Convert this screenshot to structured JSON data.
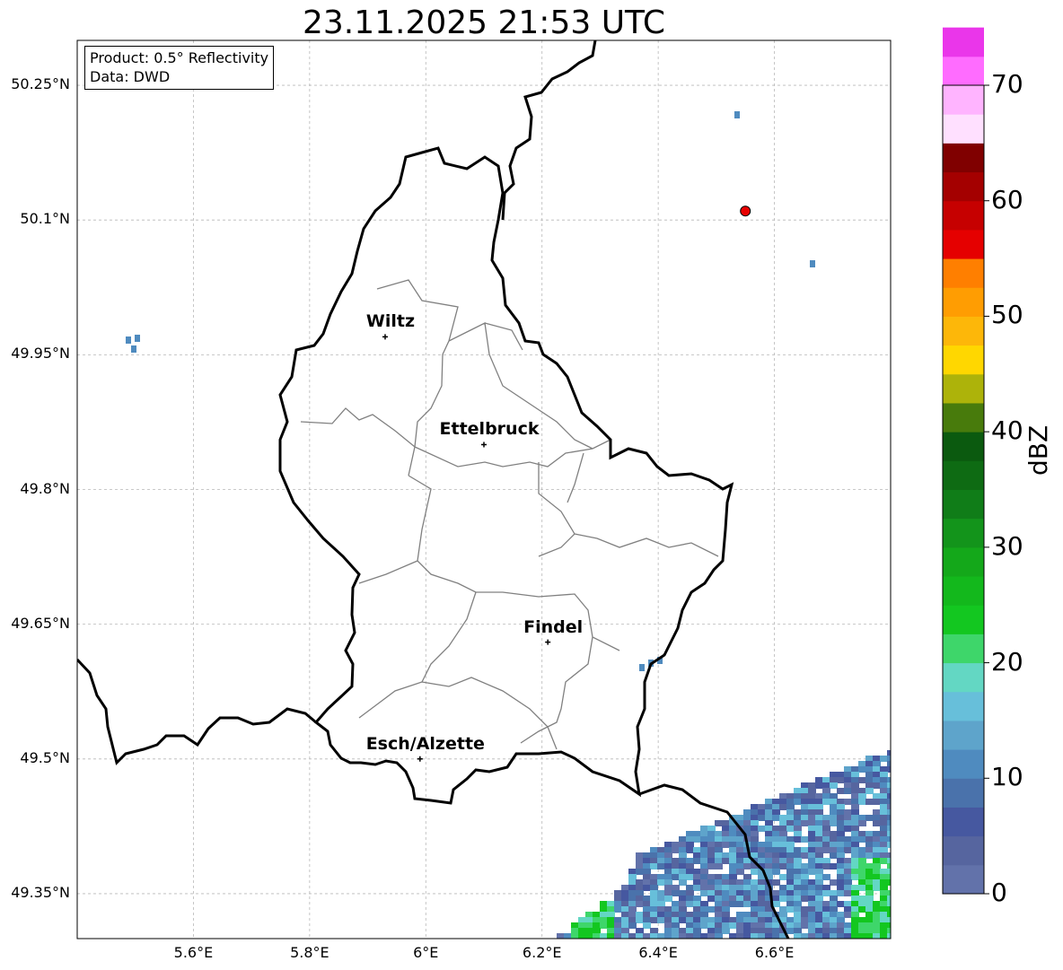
{
  "title": "23.11.2025 21:53 UTC",
  "info": {
    "product": "Product: 0.5° Reflectivity",
    "data": "Data: DWD"
  },
  "axes": {
    "lon_ticks": [
      "5.6°E",
      "5.8°E",
      "6°E",
      "6.2°E",
      "6.4°E",
      "6.6°E"
    ],
    "lat_ticks": [
      "50.25°N",
      "50.1°N",
      "49.95°N",
      "49.8°N",
      "49.65°N",
      "49.5°N",
      "49.35°N"
    ],
    "lon_values": [
      5.6,
      5.8,
      6.0,
      6.2,
      6.4,
      6.6
    ],
    "lat_values": [
      50.25,
      50.1,
      49.95,
      49.8,
      49.65,
      49.5,
      49.35
    ],
    "lon_range": [
      5.4,
      6.8
    ],
    "lat_range": [
      49.3,
      50.3
    ],
    "grid": true
  },
  "cities": [
    {
      "name": "Wiltz",
      "lon": 5.93,
      "lat": 49.97
    },
    {
      "name": "Ettelbruck",
      "lon": 6.1,
      "lat": 49.85
    },
    {
      "name": "Findel",
      "lon": 6.21,
      "lat": 49.63
    },
    {
      "name": "Esch/Alzette",
      "lon": 5.99,
      "lat": 49.5
    }
  ],
  "radar_site": {
    "lon": 6.55,
    "lat": 50.11,
    "color": "#e80000"
  },
  "colorbar": {
    "label": "dBZ",
    "ticks": [
      "0",
      "10",
      "20",
      "30",
      "40",
      "50",
      "60",
      "70"
    ],
    "min": 0,
    "max": 70,
    "step": 2.5,
    "colors": [
      "#6272aa",
      "#56659f",
      "#4658a0",
      "#4a72ab",
      "#4f8bbf",
      "#5ea4cb",
      "#67bfda",
      "#63d7c3",
      "#3ed66a",
      "#13c720",
      "#13b81c",
      "#14a81a",
      "#13941b",
      "#107d18",
      "#0e6b13",
      "#0b5a0f",
      "#487b0c",
      "#adb30a",
      "#ffd700",
      "#fdb709",
      "#ff9d02",
      "#ff7f00",
      "#e50000",
      "#c60000",
      "#a40000",
      "#800000",
      "#ffe0ff",
      "#ffb4ff",
      "#ff6cff",
      "#ea36ea"
    ]
  },
  "colors": {
    "country_border": "#000000",
    "canton_border": "#808080",
    "grid": "#b8b8b8"
  }
}
